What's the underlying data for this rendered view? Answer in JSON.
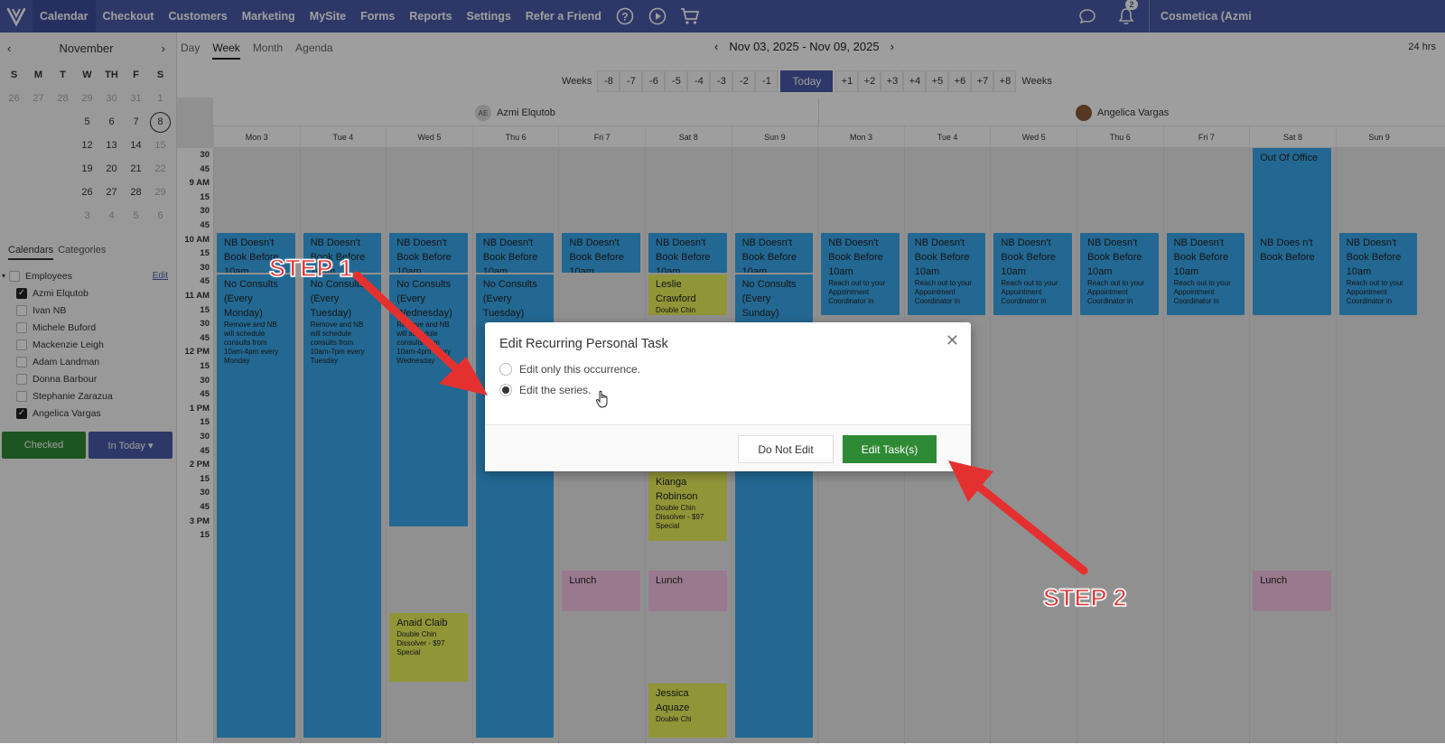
{
  "nav": {
    "items": [
      "Calendar",
      "Checkout",
      "Customers",
      "Marketing",
      "MySite",
      "Forms",
      "Reports",
      "Settings",
      "Refer a Friend"
    ],
    "notification_count": "2",
    "account": "Cosmetica (Azmi"
  },
  "mini_calendar": {
    "month": "November",
    "dow": [
      "S",
      "M",
      "T",
      "W",
      "TH",
      "F",
      "S"
    ],
    "weeks": [
      [
        "26",
        "27",
        "28",
        "29",
        "30",
        "31",
        "1"
      ],
      [
        "",
        "",
        "",
        "5",
        "6",
        "7",
        "8"
      ],
      [
        "",
        "",
        "",
        "12",
        "13",
        "14",
        "15"
      ],
      [
        "",
        "",
        "",
        "19",
        "20",
        "21",
        "22"
      ],
      [
        "",
        "",
        "",
        "26",
        "27",
        "28",
        "29"
      ],
      [
        "",
        "",
        "",
        "3",
        "4",
        "5",
        "6"
      ]
    ],
    "today": "8"
  },
  "sidebar": {
    "tabs": [
      "Calendars",
      "Categories"
    ],
    "group_label": "Employees",
    "edit_label": "Edit",
    "employees": [
      {
        "name": "Azmi Elqutob",
        "checked": true
      },
      {
        "name": "Ivan NB",
        "checked": false
      },
      {
        "name": "Michele Buford",
        "checked": false
      },
      {
        "name": "Mackenzie Leigh",
        "checked": false
      },
      {
        "name": "Adam Landman",
        "checked": false
      },
      {
        "name": "Donna Barbour",
        "checked": false
      },
      {
        "name": "Stephanie Zarazua",
        "checked": false
      },
      {
        "name": "Angelica Vargas",
        "checked": true
      }
    ],
    "checked_btn": "Checked",
    "in_today_btn": "In Today ▾"
  },
  "toolbar": {
    "views": [
      "Day",
      "Week",
      "Month",
      "Agenda"
    ],
    "active_view": "Week",
    "date_range": "Nov 03, 2025 - Nov 09, 2025",
    "hours_label": "24 hrs",
    "weeks_label": "Weeks",
    "weeks_minus": [
      "-8",
      "-7",
      "-6",
      "-5",
      "-4",
      "-3",
      "-2",
      "-1"
    ],
    "today": "Today",
    "weeks_plus": [
      "+1",
      "+2",
      "+3",
      "+4",
      "+5",
      "+6",
      "+7",
      "+8"
    ]
  },
  "staff": [
    {
      "initials": "AE",
      "name": "Azmi Elqutob"
    },
    {
      "initials": "",
      "name": "Angelica Vargas"
    }
  ],
  "days": [
    "Mon 3",
    "Tue 4",
    "Wed 5",
    "Thu 6",
    "Fri 7",
    "Sat 8",
    "Sun 9",
    "Mon 3",
    "Tue 4",
    "Wed 5",
    "Thu 6",
    "Fri 7",
    "Sat 8",
    "Sun 9"
  ],
  "time_labels": [
    "30",
    "45",
    "9 AM",
    "15",
    "30",
    "45",
    "10 AM",
    "15",
    "30",
    "45",
    "11 AM",
    "15",
    "30",
    "45",
    "12 PM",
    "15",
    "30",
    "45",
    "1 PM",
    "15",
    "30",
    "45",
    "2 PM",
    "15",
    "30",
    "45",
    "3 PM",
    "15"
  ],
  "events": {
    "nb_title": "NB Doesn't Book Before 10am",
    "nb_short": "NB Does n't Book Before",
    "reach_out": "Reach out to your Appointment Coordinator in",
    "no_consults_mon": "No Consults (Every Monday)",
    "no_consults_mon_note": "Remove and NB will schedule consults from 10am-4pm every Monday",
    "no_consults_tue": "No Consults (Every Tuesday)",
    "no_consults_tue_note": "Remove and NB will schedule consults from 10am-7pm every Tuesday",
    "no_consults_wed": "No Consults (Every Wednesday)",
    "no_consults_wed_note": "Remove and NB will schedule consults from 10am-4pm every Wednesday",
    "no_consults_thu": "No Consults (Every Tuesday)",
    "no_consults_sun": "No Consults (Every Sunday)",
    "leslie": "Leslie Crawford",
    "leslie_note": "Double Chin",
    "kianga": "Kianga Robinson",
    "kianga_note": "Double Chin Dissolver - $97 Special",
    "lunch": "Lunch",
    "anaid": "Anaid Claib",
    "anaid_note": "Double Chin Dissolver - $97 Special",
    "jessica": "Jessica Aquaze",
    "jessica_note": "Double Chi",
    "ooo": "Out Of Office"
  },
  "modal": {
    "title": "Edit Recurring Personal Task",
    "option1": "Edit only this occurrence.",
    "option2": "Edit the series.",
    "selected": "option2",
    "cancel": "Do Not Edit",
    "confirm": "Edit Task(s)"
  },
  "annotations": {
    "step1": "STEP 1",
    "step2": "STEP 2",
    "arrow_color": "#e53030"
  }
}
